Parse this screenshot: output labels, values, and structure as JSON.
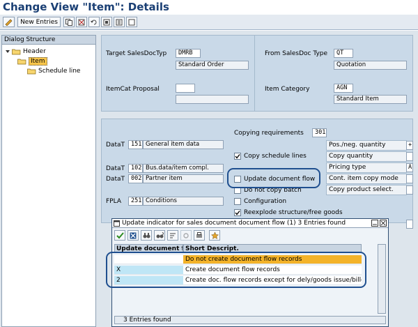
{
  "window": {
    "title": "Change View \"Item\": Details"
  },
  "toolbar": {
    "new_entries": "New Entries"
  },
  "tree": {
    "heading": "Dialog Structure",
    "items": [
      {
        "label": "Header"
      },
      {
        "label": "Item"
      },
      {
        "label": "Schedule line"
      }
    ]
  },
  "header_panel": {
    "target_label": "Target SalesDocTyp",
    "target_value": "DMRB",
    "target_desc": "Standard Order",
    "from_label": "From SalesDoc Type",
    "from_value": "QT",
    "from_desc": "Quotation",
    "itemcat_proposal_label": "ItemCat Proposal",
    "itemcat_proposal_value": "",
    "item_category_label": "Item Category",
    "item_category_value": "AGN",
    "item_category_desc": "Standard Item"
  },
  "routines": [
    {
      "label": "DataT",
      "number": "151",
      "desc": "General item data"
    },
    {
      "label": "DataT",
      "number": "102",
      "desc": "Bus.data/item compl."
    },
    {
      "label": "DataT",
      "number": "002",
      "desc": "Partner item"
    },
    {
      "label": "FPLA",
      "number": "251",
      "desc": "Conditions"
    }
  ],
  "copy": {
    "requirements_label": "Copying requirements",
    "requirements_value": "301",
    "copy_schedule_lines": "Copy schedule lines",
    "update_doc_flow": "Update document flow",
    "do_not_copy_batch": "Do not copy batch",
    "configuration": "Configuration",
    "reexplode": "Reexplode structure/free goods"
  },
  "qty_grid": [
    {
      "label": "Pos./neg. quantity",
      "value": "+"
    },
    {
      "label": "Copy quantity",
      "value": ""
    },
    {
      "label": "Pricing type",
      "value": "A"
    },
    {
      "label": "Cont. item copy mode",
      "value": ""
    },
    {
      "label": "Copy product select.",
      "value": ""
    }
  ],
  "popup": {
    "title": "Update indicator for sales document document flow (1)   3 Entries found",
    "col1": "Update document fl",
    "col2": "Short Descript.",
    "rows": [
      {
        "key": "",
        "desc": "Do not create document flow records"
      },
      {
        "key": "X",
        "desc": "Create document flow records"
      },
      {
        "key": "2",
        "desc": "Create doc. flow records except for dely/goods issue/billdoc"
      }
    ],
    "status": "3 Entries found"
  }
}
